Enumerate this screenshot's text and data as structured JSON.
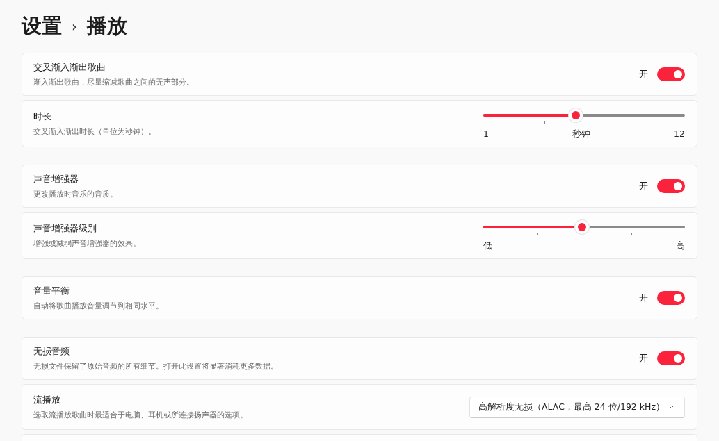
{
  "breadcrumb": {
    "parent": "设置",
    "separator": "›",
    "current": "播放"
  },
  "groups": [
    [
      {
        "kind": "toggle",
        "title": "交叉渐入渐出歌曲",
        "description": "渐入渐出歌曲，尽量缩减歌曲之间的无声部分。",
        "state_label": "开",
        "on": true
      },
      {
        "kind": "slider",
        "title": "时长",
        "description": "交叉渐入渐出时长（单位为秒钟）。",
        "level": 0.46,
        "min_label": "1",
        "mid_label": "秒钟",
        "max_label": "12"
      }
    ],
    [
      {
        "kind": "toggle",
        "title": "声音增强器",
        "description": "更改播放时音乐的音质。",
        "state_label": "开",
        "on": true
      },
      {
        "kind": "slider",
        "title": "声音增强器级别",
        "description": "增强或减弱声音增强器的效果。",
        "level": 0.49,
        "min_label": "低",
        "max_label": "高"
      }
    ],
    [
      {
        "kind": "toggle",
        "title": "音量平衡",
        "description": "自动将歌曲播放音量调节到相同水平。",
        "state_label": "开",
        "on": true
      }
    ],
    [
      {
        "kind": "toggle",
        "title": "无损音频",
        "description": "无损文件保留了原始音频的所有细节。打开此设置将显著消耗更多数据。",
        "state_label": "开",
        "on": true
      },
      {
        "kind": "dropdown",
        "title": "流播放",
        "description": "选取流播放歌曲时最适合于电脑、耳机或所连接扬声器的选项。",
        "value": "高解析度无损（ALAC，最高 24 位/192 kHz）"
      },
      {
        "kind": "empty"
      }
    ]
  ]
}
